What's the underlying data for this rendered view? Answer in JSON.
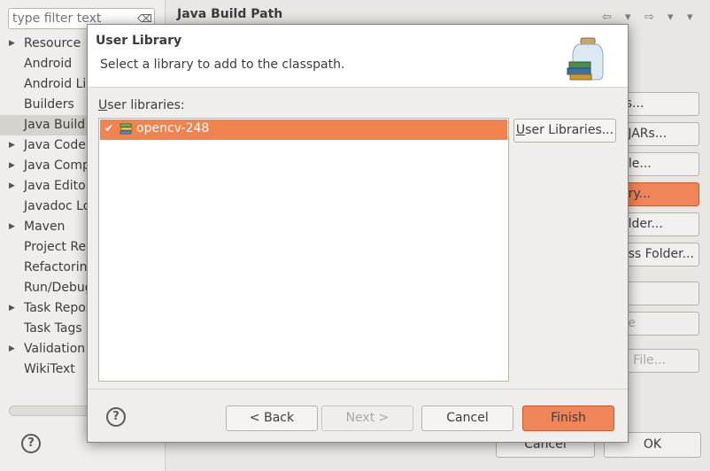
{
  "background_window": {
    "filter_placeholder": "type filter text",
    "page_title": "Java Build Path",
    "tree_items": [
      {
        "label": "Resource",
        "expandable": true
      },
      {
        "label": "Android",
        "expandable": false
      },
      {
        "label": "Android Li",
        "expandable": false
      },
      {
        "label": "Builders",
        "expandable": false
      },
      {
        "label": "Java Build",
        "expandable": false,
        "selected": true
      },
      {
        "label": "Java Code",
        "expandable": true
      },
      {
        "label": "Java Comp",
        "expandable": true
      },
      {
        "label": "Java Edito",
        "expandable": true
      },
      {
        "label": "Javadoc Lo",
        "expandable": false
      },
      {
        "label": "Maven",
        "expandable": true
      },
      {
        "label": "Project Re",
        "expandable": false
      },
      {
        "label": "Refactorin",
        "expandable": false
      },
      {
        "label": "Run/Debug",
        "expandable": false
      },
      {
        "label": "Task Repos",
        "expandable": true
      },
      {
        "label": "Task Tags",
        "expandable": false
      },
      {
        "label": "Validation",
        "expandable": true
      },
      {
        "label": "WikiText",
        "expandable": false
      }
    ],
    "side_buttons": [
      {
        "label": "rs...",
        "state": "normal"
      },
      {
        "label": "l JARs...",
        "state": "normal"
      },
      {
        "label": "ble...",
        "state": "normal"
      },
      {
        "label": "ary...",
        "state": "highlighted"
      },
      {
        "label": "older...",
        "state": "normal"
      },
      {
        "label": "ass Folder...",
        "state": "normal"
      },
      {
        "label": ".",
        "state": "disabled"
      },
      {
        "label": "ve",
        "state": "disabled"
      },
      {
        "label": "R File...",
        "state": "disabled"
      }
    ],
    "cancel_label": "Cancel",
    "ok_label": "OK",
    "help_glyph": "?"
  },
  "dialog": {
    "title": "User Library",
    "description": "Select a library to add to the classpath.",
    "user_libraries_label_prefix": "U",
    "user_libraries_label_rest": "ser libraries:",
    "libraries": [
      {
        "name": "opencv-248",
        "checked": true
      }
    ],
    "user_libraries_button_prefix": "U",
    "user_libraries_button_rest": "ser Libraries...",
    "buttons": {
      "back": "< Back",
      "next": "Next >",
      "cancel": "Cancel",
      "finish": "Finish"
    },
    "help_glyph": "?"
  },
  "colors": {
    "accent": "#f0834e",
    "window_bg": "#efeeec"
  },
  "icons": {
    "filter_clear": "clear-filter-icon",
    "library": "library-jar-icon",
    "banner": "library-jar-banner-icon"
  }
}
